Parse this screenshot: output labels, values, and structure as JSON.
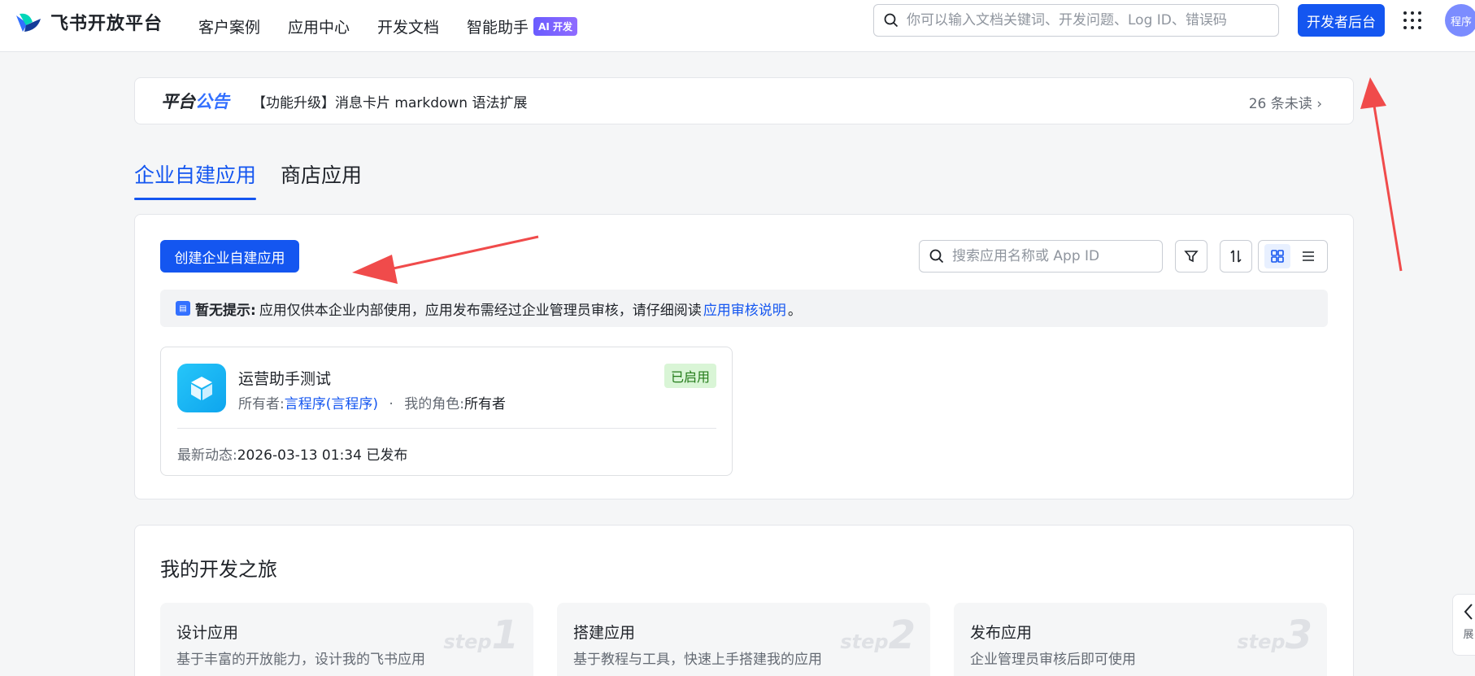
{
  "header": {
    "logo_text": "飞书开放平台",
    "nav": [
      {
        "label": "客户案例"
      },
      {
        "label": "应用中心"
      },
      {
        "label": "开发文档"
      },
      {
        "label": "智能助手",
        "badge": "AI 开发"
      }
    ],
    "search_placeholder": "你可以输入文档关键词、开发问题、Log ID、错误码",
    "console_button": "开发者后台",
    "avatar_text": "程序"
  },
  "announcement": {
    "title_part1": "平台",
    "title_part2": "公告",
    "text": "【功能升级】消息卡片 markdown 语法扩展",
    "unread": "26 条未读",
    "unread_icon": "chevron-right-icon"
  },
  "tabs": [
    {
      "label": "企业自建应用",
      "active": true
    },
    {
      "label": "商店应用",
      "active": false
    }
  ],
  "apps": {
    "create_button": "创建企业自建应用",
    "search_placeholder": "搜索应用名称或 App ID",
    "notice": {
      "label": "暂无提示:",
      "text": "应用仅供本企业内部使用，应用发布需经过企业管理员审核，请仔细阅读",
      "link": "应用审核说明",
      "end": "。"
    },
    "items": [
      {
        "name": "运营助手测试",
        "status": "已启用",
        "owner_label": "所有者:",
        "owner": "言程序(言程序)",
        "separator": "·",
        "role_label": "我的角色:",
        "role": "所有者",
        "latest_label": "最新动态:",
        "latest": "2026-03-13 01:34 已发布"
      }
    ]
  },
  "journey": {
    "title": "我的开发之旅",
    "steps": [
      {
        "title": "设计应用",
        "desc": "基于丰富的开放能力，设计我的飞书应用",
        "tag": "step",
        "num": "1"
      },
      {
        "title": "搭建应用",
        "desc": "基于教程与工具，快速上手搭建我的应用",
        "tag": "step",
        "num": "2"
      },
      {
        "title": "发布应用",
        "desc": "企业管理员审核后即可使用",
        "tag": "step",
        "num": "3"
      }
    ]
  },
  "side_tab": {
    "label": "展"
  },
  "colors": {
    "brand": "#1456f0",
    "status_green": "#237b19",
    "annotation_arrow": "#f04b4b"
  }
}
